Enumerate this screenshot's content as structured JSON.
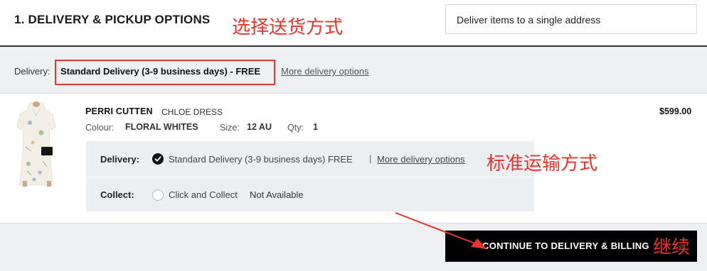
{
  "header": {
    "title": "1. DELIVERY & PICKUP OPTIONS",
    "annotation": "选择送货方式",
    "address_select": "Deliver items to a single address"
  },
  "delivery_band": {
    "label": "Delivery:",
    "selected": "Standard Delivery (3-9 business days) - FREE",
    "more_link": "More delivery options"
  },
  "item": {
    "brand": "PERRI CUTTEN",
    "name": "CHLOE DRESS",
    "price": "$599.00",
    "colour_label": "Colour:",
    "colour_value": "FLORAL WHITES",
    "size_label": "Size:",
    "size_value": "12 AU",
    "qty_label": "Qty:",
    "qty_value": "1"
  },
  "options": {
    "delivery_label": "Delivery:",
    "delivery_text": "Standard Delivery (3-9 business days) FREE",
    "separator": "|",
    "delivery_link": "More delivery options",
    "collect_label": "Collect:",
    "collect_text": "Click and Collect",
    "collect_status": "Not Available",
    "annotation": "标准运输方式"
  },
  "footer": {
    "continue_label": "CONTINUE TO DELIVERY & BILLING",
    "annotation": "继续"
  },
  "colors": {
    "accent_red": "#e8332c",
    "band_bg": "#eef0f2",
    "button_bg": "#000000"
  }
}
